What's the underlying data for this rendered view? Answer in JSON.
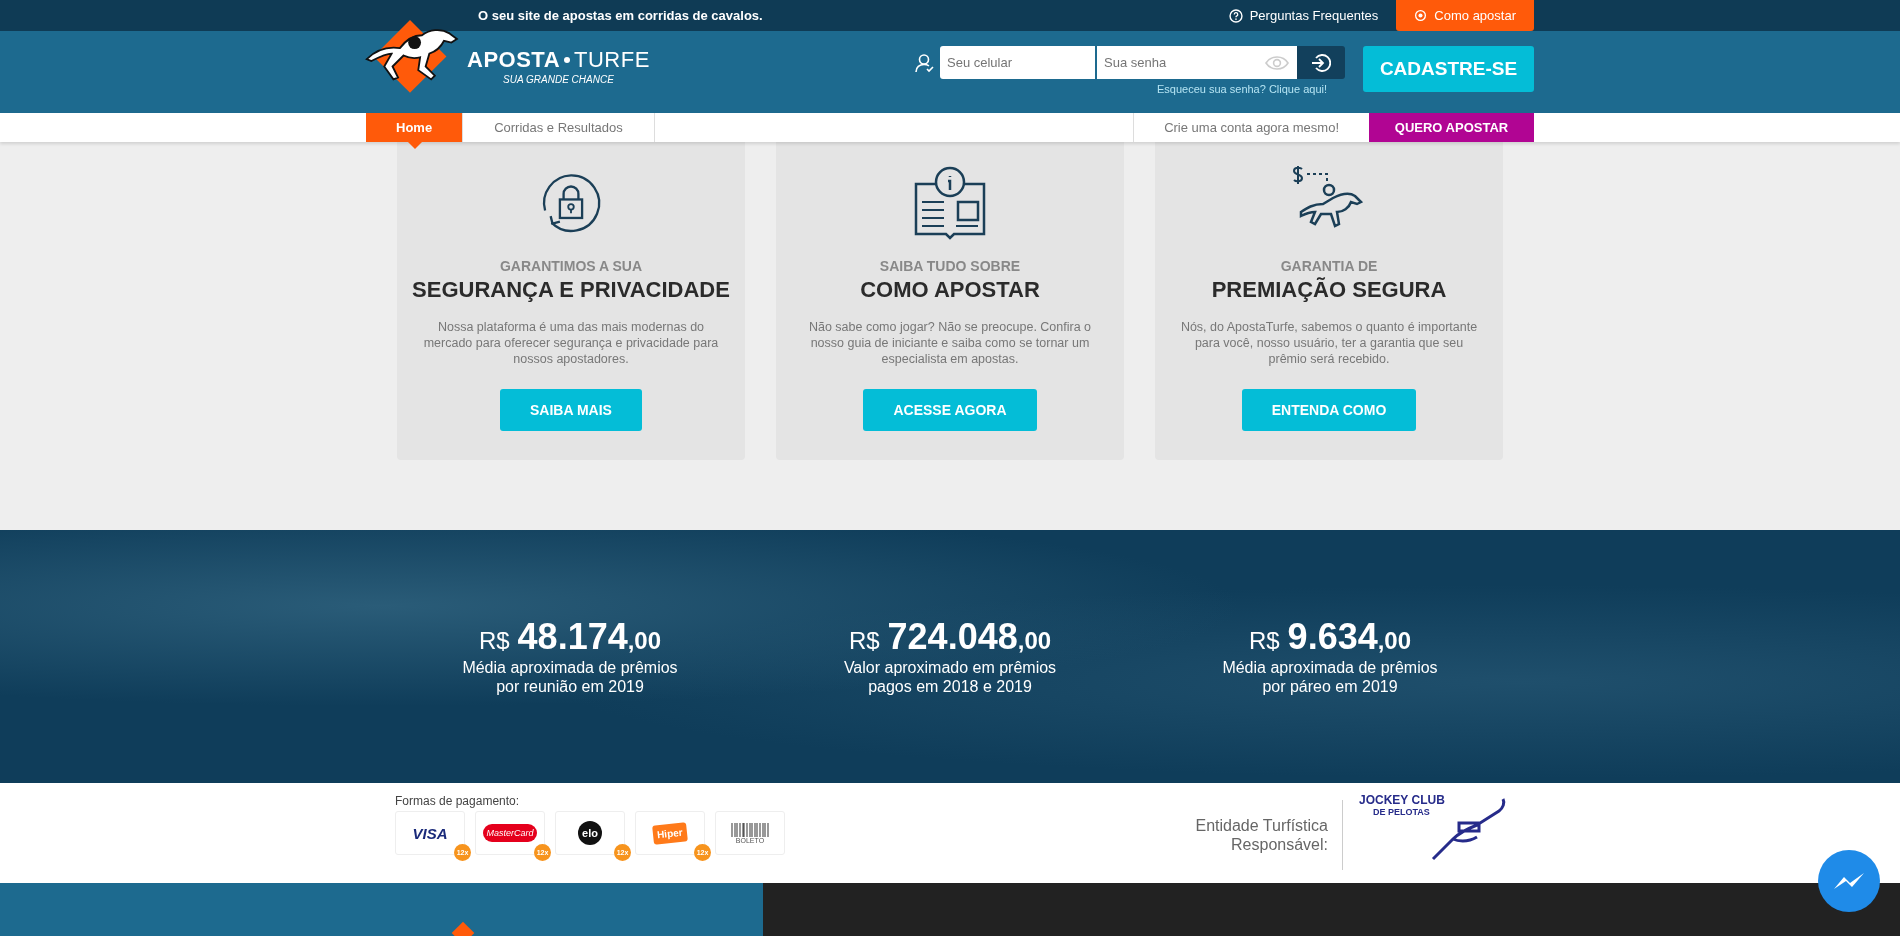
{
  "top_bar": {
    "tagline": "O seu site de apostas em corridas de cavalos.",
    "help_link": "Perguntas Frequentes",
    "how_to_button": "Como apostar"
  },
  "brand": {
    "name_left": "APOSTA",
    "name_right": "TURFE",
    "tagline": "SUA GRANDE CHANCE"
  },
  "login": {
    "phone_placeholder": "Seu celular",
    "password_placeholder": "Sua senha",
    "forgot_link": "Esqueceu sua senha? Clique aqui!"
  },
  "signup_button": "CADASTRE-SE",
  "nav": {
    "items": [
      {
        "label": "Home",
        "selected": true
      },
      {
        "label": "Corridas e Resultados",
        "selected": false
      }
    ],
    "create_account_link": "Crie uma conta agora mesmo!",
    "bet_button": "QUERO APOSTAR"
  },
  "features": [
    {
      "kind": "security",
      "subtitle": "GARANTIMOS A SUA",
      "title": "SEGURANÇA E PRIVACIDADE",
      "description": "Nossa plataforma é uma das mais modernas do mercado para oferecer segurança e privacidade para nossos apostadores.",
      "button": "SAIBA MAIS"
    },
    {
      "kind": "guide",
      "subtitle": "SAIBA TUDO SOBRE",
      "title": "COMO APOSTAR",
      "description": "Não sabe como jogar? Não se preocupe. Confira o nosso guia de iniciante e saiba como se tornar um especialista em apostas.",
      "button": "ACESSE AGORA"
    },
    {
      "kind": "prize",
      "subtitle": "GARANTIA DE",
      "title": "PREMIAÇÃO SEGURA",
      "description": "Nós, do ApostaTurfe, sabemos o quanto é importante para você, nosso usuário, ter a garantia que seu prêmio será recebido.",
      "button": "ENTENDA COMO"
    }
  ],
  "stats": [
    {
      "currency": "R$",
      "value": "48.174",
      "cents": ",00",
      "label": "Média aproximada de prêmios\npor reunião em 2019"
    },
    {
      "currency": "R$",
      "value": "724.048",
      "cents": ",00",
      "label": "Valor aproximado em prêmios\npagos em 2018 e 2019"
    },
    {
      "currency": "R$",
      "value": "9.634",
      "cents": ",00",
      "label": "Média aproximada de prêmios\npor páreo em 2019"
    }
  ],
  "footer": {
    "payment_title": "Formas de pagamento:",
    "payment_methods": [
      {
        "kind": "visa",
        "label": "VISA",
        "installments": "12x"
      },
      {
        "kind": "mastercard",
        "label": "MasterCard",
        "installments": "12x"
      },
      {
        "kind": "elo",
        "label": "elo",
        "installments": "12x"
      },
      {
        "kind": "hiper",
        "label": "Hiper",
        "installments": "12x"
      },
      {
        "kind": "boleto",
        "label": "BOLETO"
      }
    ],
    "entity_label": "Entidade Turfística\nResponsável:",
    "entity_logo": {
      "title": "JOCKEY CLUB",
      "subtitle": "DE PELOTAS"
    }
  }
}
